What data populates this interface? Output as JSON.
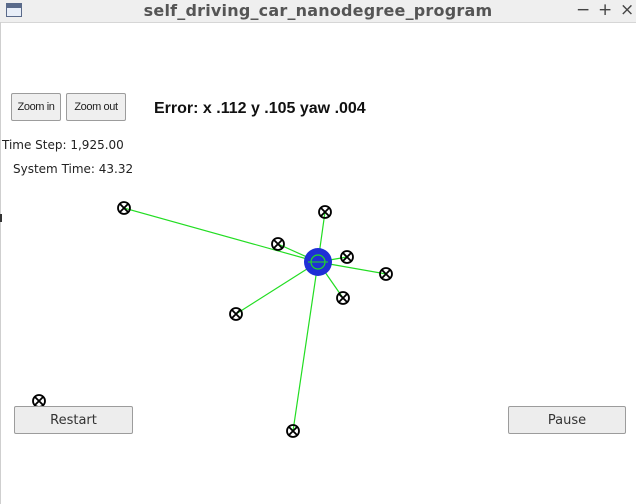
{
  "window": {
    "title": "self_driving_car_nanodegree_program",
    "minimize_glyph": "−",
    "maximize_glyph": "+",
    "close_glyph": "×"
  },
  "toolbar": {
    "zoom_in_label": "Zoom in",
    "zoom_out_label": "Zoom out"
  },
  "error_text": "Error: x .112 y .105 yaw .004",
  "time_step_text": "Time Step: 1,925.00",
  "system_time_text": "System Time: 43.32",
  "controls": {
    "restart_label": "Restart",
    "pause_label": "Pause"
  },
  "colors": {
    "link_line": "#22dd22",
    "vehicle": "#1f2fd6",
    "landmark_stroke": "#000000"
  }
}
